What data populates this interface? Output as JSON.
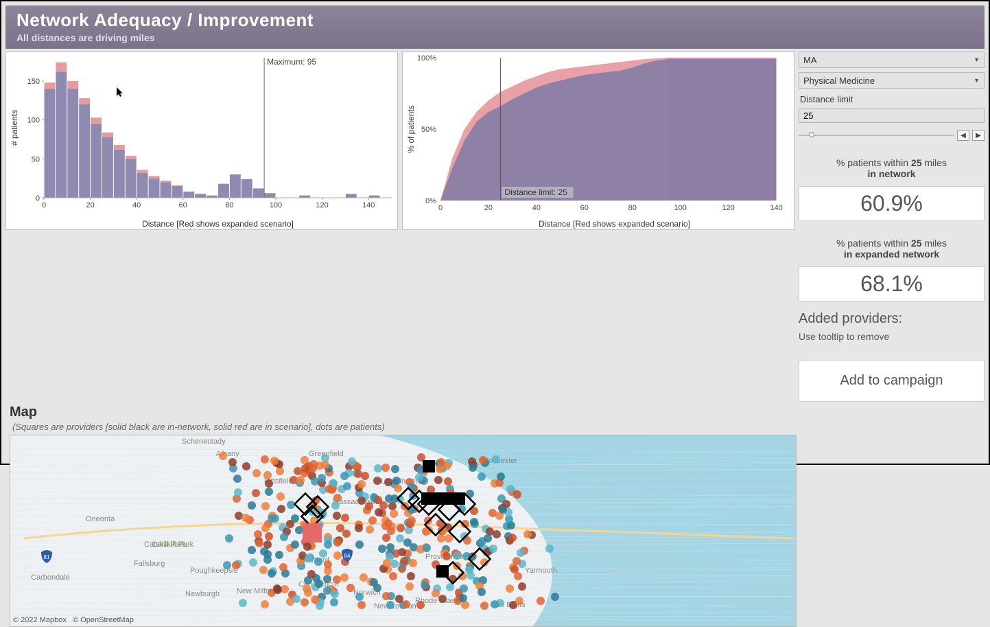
{
  "header": {
    "title": "Network Adequacy / Improvement",
    "subtitle": "All distances are driving miles"
  },
  "filters": {
    "state": "MA",
    "specialty": "Physical Medicine",
    "distance_limit_label": "Distance limit",
    "distance_limit_value": "25"
  },
  "kpi": {
    "within_label_1a": "% patients within ",
    "within_miles": "25",
    "within_label_1b": " miles",
    "in_network": "in network",
    "within_pct": "60.9%",
    "exp_label": "in expanded network",
    "exp_pct": "68.1%"
  },
  "added": {
    "header": "Added providers:",
    "sub": "Use tooltip to remove"
  },
  "button": {
    "campaign": "Add to campaign"
  },
  "map": {
    "title": "Map",
    "subtitle": "(Squares are providers [solid black are in-network, solid red are in scenario], dots are patients)",
    "credit1": "© 2022 Mapbox",
    "credit2": "© OpenStreetMap"
  },
  "chart_data": [
    {
      "type": "bar",
      "title": "",
      "xlabel": "Distance [Red shows expanded scenario]",
      "ylabel": "# patients",
      "xticks": [
        0,
        20,
        40,
        60,
        80,
        100,
        120,
        140
      ],
      "yticks": [
        0,
        50,
        100,
        150
      ],
      "ylim": [
        0,
        180
      ],
      "annotation": "Maximum: 95",
      "annotation_x": 95,
      "bin_edges": [
        0,
        5,
        10,
        15,
        20,
        25,
        30,
        35,
        40,
        45,
        50,
        55,
        60,
        65,
        70,
        75,
        80,
        85,
        90,
        95,
        100,
        105,
        110,
        115,
        120,
        125,
        130,
        135,
        140,
        145
      ],
      "series": [
        {
          "name": "in-network",
          "color": "#8f8ab0",
          "values": [
            140,
            162,
            140,
            120,
            95,
            78,
            62,
            50,
            32,
            25,
            20,
            15,
            8,
            5,
            3,
            18,
            30,
            24,
            12,
            6,
            0,
            0,
            3,
            0,
            0,
            0,
            5,
            0,
            3
          ]
        },
        {
          "name": "expanded",
          "color": "#e79aa0",
          "values": [
            8,
            12,
            10,
            8,
            8,
            6,
            6,
            4,
            4,
            3,
            2,
            1,
            0,
            0,
            0,
            0,
            0,
            0,
            0,
            0,
            0,
            0,
            0,
            0,
            0,
            0,
            0,
            0,
            0
          ]
        }
      ]
    },
    {
      "type": "area",
      "title": "",
      "xlabel": "Distance [Red shows expanded scenario]",
      "ylabel": "% of patients",
      "xticks": [
        0,
        20,
        40,
        60,
        80,
        100,
        120,
        140
      ],
      "yticks": [
        0,
        50,
        100
      ],
      "ylim": [
        0,
        100
      ],
      "annotation": "Distance limit: 25",
      "annotation_x": 25,
      "max_x": 95,
      "x": [
        0,
        5,
        10,
        15,
        20,
        25,
        30,
        35,
        40,
        45,
        50,
        55,
        60,
        65,
        70,
        75,
        80,
        85,
        90,
        95,
        100,
        140
      ],
      "series": [
        {
          "name": "in-network",
          "color": "#7f7aa6",
          "y": [
            0,
            23,
            42,
            55,
            62,
            66,
            71,
            75,
            79,
            82,
            84,
            86,
            88,
            89,
            90,
            91,
            93,
            96,
            98,
            99,
            99,
            99
          ]
        },
        {
          "name": "expanded",
          "color": "#e48a92",
          "y": [
            0,
            30,
            50,
            62,
            70,
            76,
            80,
            84,
            87,
            90,
            92,
            93,
            94,
            95,
            96,
            97,
            98,
            99,
            99.5,
            100,
            100,
            100
          ]
        }
      ]
    }
  ]
}
